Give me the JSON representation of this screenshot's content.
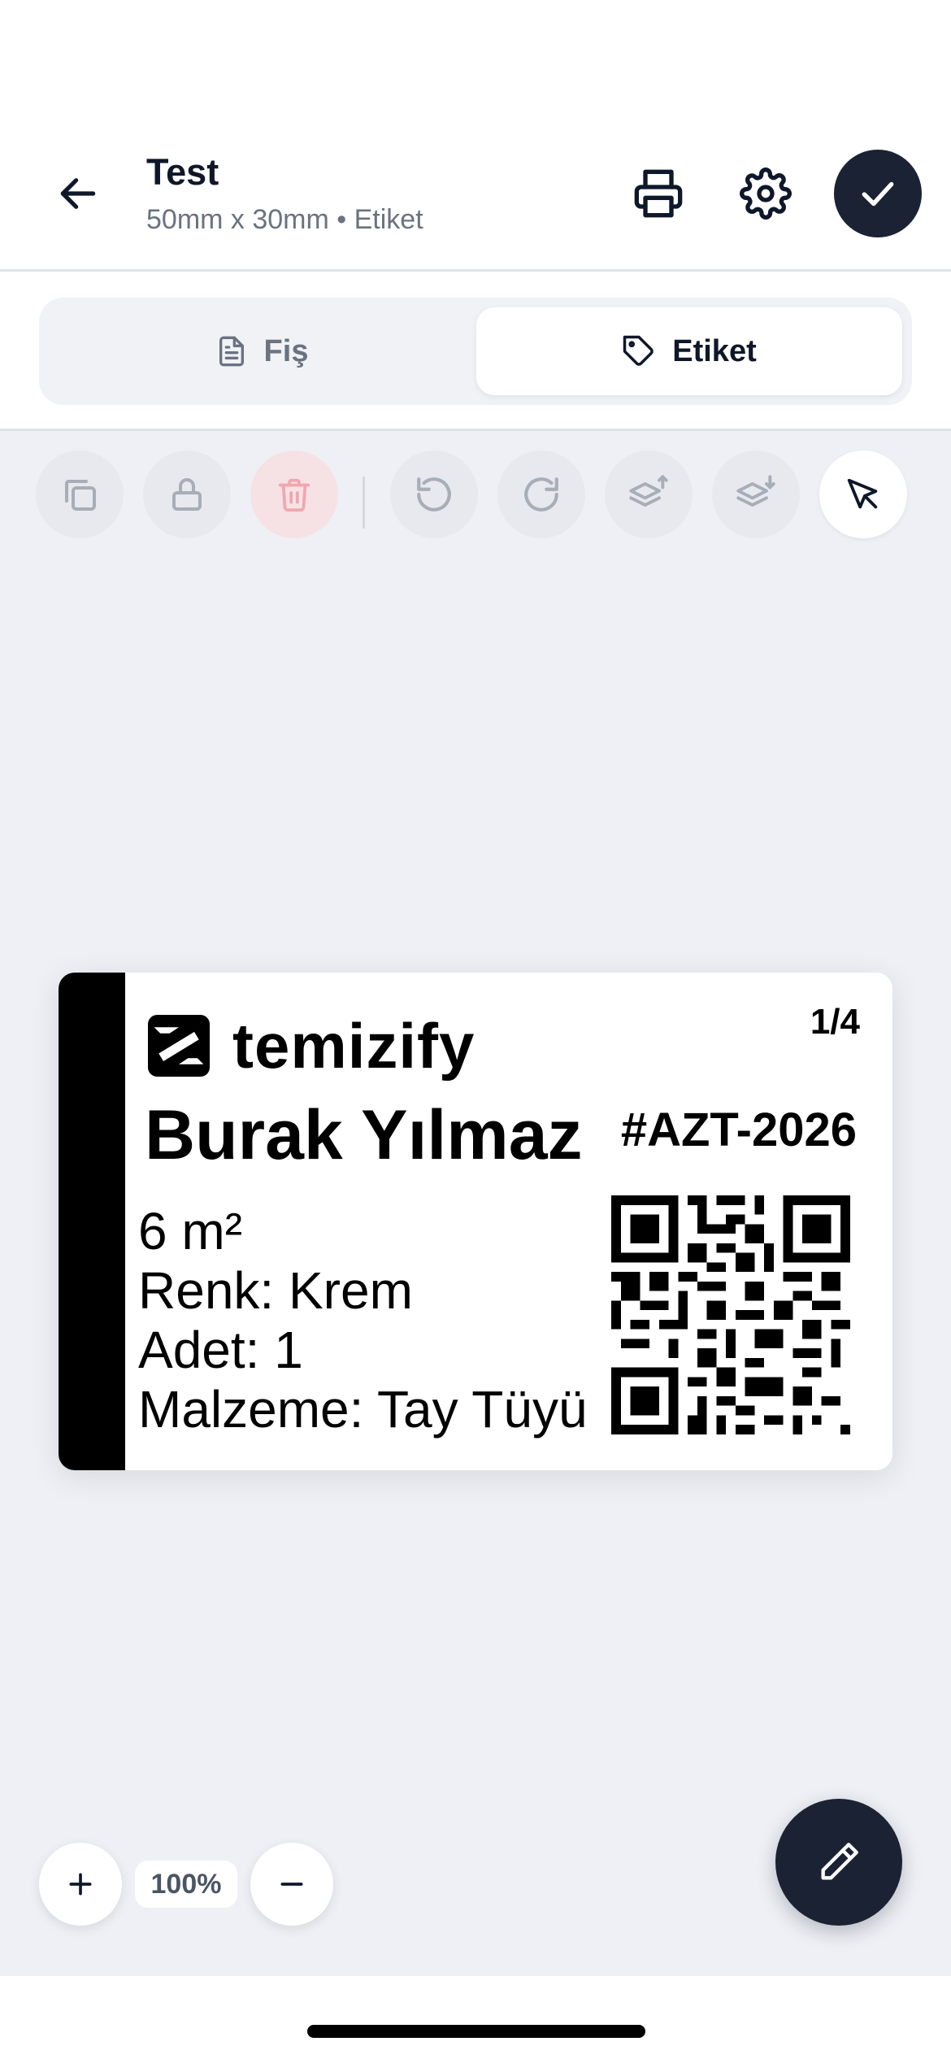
{
  "header": {
    "title": "Test",
    "subtitle": "50mm x 30mm • Etiket"
  },
  "mode_toggle": {
    "tabs": [
      {
        "label": "Fiş",
        "icon": "document-icon",
        "selected": false
      },
      {
        "label": "Etiket",
        "icon": "tag-icon",
        "selected": true
      }
    ]
  },
  "toolbar": {
    "tools": [
      "duplicate-icon",
      "lock-icon",
      "trash-icon",
      "undo-icon",
      "redo-icon",
      "layer-up-icon",
      "layer-down-icon",
      "select-cursor-icon"
    ],
    "delete_color": "#f0a7b0"
  },
  "label": {
    "brand": "temizify",
    "page": "1/4",
    "customer": "Burak Yılmaz",
    "order_code": "#AZT-2026",
    "details": [
      "6 m²",
      "Renk: Krem",
      "Adet: 1",
      "Malzeme: Tay Tüyü"
    ]
  },
  "zoom": {
    "level": "100%"
  },
  "colors": {
    "primary_dark": "#1a2233",
    "canvas_bg": "#eef0f5"
  }
}
